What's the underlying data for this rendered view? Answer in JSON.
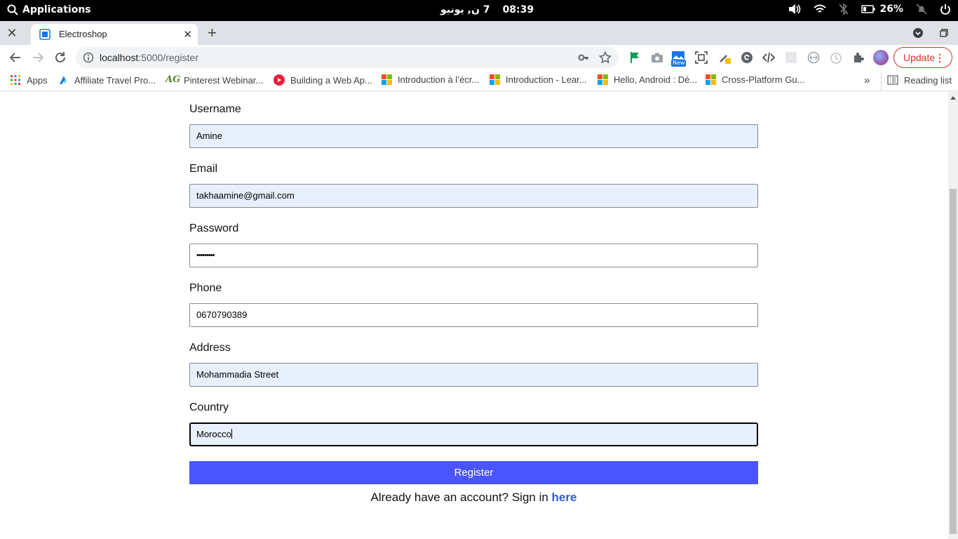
{
  "system_bar": {
    "menu_label": "Applications",
    "date": "7  ن, يونيو",
    "time": "08:39",
    "battery": "26%"
  },
  "browser": {
    "tab_title": "Electroshop",
    "url_host": "localhost",
    "url_path": ":5000/register",
    "update_label": "Update",
    "extension_badge": "New"
  },
  "bookmarks": [
    {
      "label": "Apps"
    },
    {
      "label": "Affiliate Travel Pro..."
    },
    {
      "label": "Pinterest Webinar..."
    },
    {
      "label": "Building a Web Ap..."
    },
    {
      "label": "Introduction à l’écr..."
    },
    {
      "label": "Introduction - Lear..."
    },
    {
      "label": "Hello, Android : Dé..."
    },
    {
      "label": "Cross-Platform Gu..."
    }
  ],
  "reading_list": "Reading list",
  "form": {
    "username": {
      "label": "Username",
      "value": "Amine"
    },
    "email": {
      "label": "Email",
      "value": "takhaamine@gmail.com"
    },
    "password": {
      "label": "Password",
      "value": "•••••••••"
    },
    "phone": {
      "label": "Phone",
      "value": "0670790389"
    },
    "address": {
      "label": "Address",
      "value": "Mohammadia Street"
    },
    "country": {
      "label": "Country",
      "value": "Morocco"
    },
    "submit_label": "Register",
    "signin_prompt": "Already have an account? Sign in ",
    "signin_link": "here"
  },
  "colors": {
    "primary_button": "#4a55ff",
    "link": "#2f5bd6",
    "autofill": "#e8f0fe",
    "update": "#d93025"
  }
}
